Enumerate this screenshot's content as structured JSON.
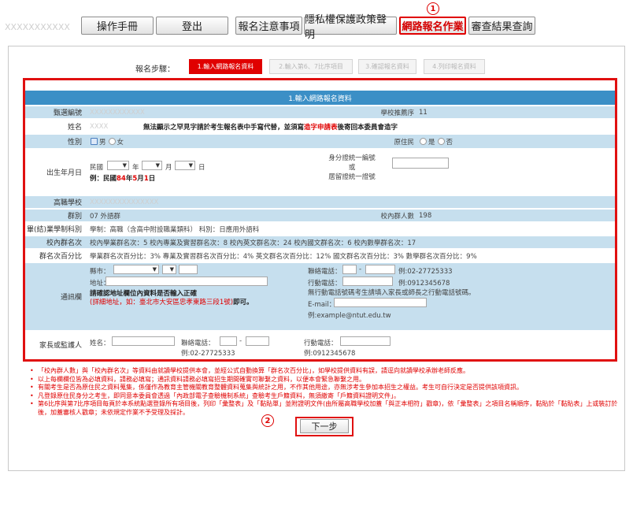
{
  "top": {
    "user_id": "XXXXXXXXXXX",
    "tabs": [
      "操作手冊",
      "登出",
      "報名注意事項",
      "隱私權保護政策聲明",
      "網路報名作業",
      "審查結果查詢"
    ],
    "marker1": "1",
    "marker2": "2"
  },
  "steps": {
    "label": "報名步驟：",
    "items": [
      "1.輸入網路報名資料",
      "2.輸入第6、7比序項目",
      "3.確認報名資料",
      "4.列印報名資料"
    ]
  },
  "form": {
    "title": "1.輸入網路報名資料",
    "exam_no_label": "甄選編號",
    "exam_no_value": "XXXXXXXXXXXX",
    "rank_label": "學校推薦序",
    "rank_value": "11",
    "name_label": "姓名",
    "name_value": "XXXX",
    "name_note_a": "無法顯示之罕見字請於考生報名表中手寫代替，並須寫",
    "name_note_b": "造字申請表",
    "name_note_c": "後寄回本委員會造字",
    "gender_label": "性別",
    "gender_male": "男",
    "gender_female": "女",
    "aboriginal_label": "原住民",
    "aboriginal_yes": "是",
    "aboriginal_no": "否",
    "birth_label": "出生年月日",
    "birth_era": "民國",
    "birth_year": "年",
    "birth_month": "月",
    "birth_day": "日",
    "birth_ex_a": "例：民國",
    "birth_ex_b": "84",
    "birth_ex_c": "年",
    "birth_ex_d": "5",
    "birth_ex_e": "月",
    "birth_ex_f": "1",
    "birth_ex_g": "日",
    "id_label_1": "身分證統一編號",
    "id_label_2": "或",
    "id_label_3": "居留證統一證號",
    "school_label": "高職學校",
    "school_value": "XXXXXXXXXXXXXXX",
    "group_label": "群別",
    "group_value": "07 外語群",
    "group_count_label": "校內群人數",
    "group_count_value": "198",
    "program_label": "畢(結)業學制科別",
    "program_value": "學制：高職（含高中附設職業類科） 科別：日應用外語科",
    "rank_in_school_label": "校內群名次",
    "rank_in_school_value": "校內學業群名次：5   校內專業及實習群名次：8   校內英文群名次：24   校內國文群名次：6   校內數學群名次：17",
    "pct_label": "群名次百分比",
    "pct_value": "學業群名次百分比：3%   專業及實習群名次百分比：4%   英文群名次百分比：12%   國文群名次百分比：3%   數學群名次百分比：9%",
    "contact_label": "通訊欄",
    "county_label": "縣市：",
    "address_label": "地址：",
    "addr_note_1": "請確認地址欄位內資料是否輸入正確",
    "addr_note_2": "(詳細地址，如：臺北市大安區忠孝東路三段1號)",
    "addr_note_3": "即可。",
    "phone_label": "聯絡電話：",
    "phone_ex": "例:02-27725333",
    "mobile_label": "行動電話：",
    "mobile_ex": "例:0912345678",
    "mobile_note": "無行動電話號碼考生請填入家長或師長之行動電話號碼。",
    "email_label": "E-mail：",
    "email_ex": "例:example@ntut.edu.tw",
    "guardian_label": "家長或監護人",
    "guardian_name_label": "姓名：",
    "guardian_phone_label": "聯絡電話：",
    "guardian_phone_ex": "例:02-27725333",
    "guardian_mobile_label": "行動電話：",
    "guardian_mobile_ex": "例:0912345678"
  },
  "notes": [
    "「校內群人數」與「校內群名次」等資料由就讀學校提供本會，並經公式自動換算「群名次百分比」，如學校提供資料有誤，請逕向就讀學校承辦老師反應。",
    "以上每欄欄位皆為必填資料，請務必填寫；通訊資料請務必填寫招生期間確實可聯繫之資料，以便本會緊急聯繫之用。",
    "有關考生是否為原住民之資料蒐集，係僅作為教育主管機關教育整體資料蒐集與統計之用，不作其他用途，亦無涉考生參加本招生之權益。考生可自行決定是否提供該項資訊。",
    "凡登錄原住民身分之考生，即同意本委員會透過「內政部電子查驗機制系統」查驗考生戶籍資料，無須繳寄「戶籍資料證明文件」。",
    "第6比序與第7比序項目每頁於本系統點選登錄所有項目後，列印「彙整表」及「黏貼單」並附證明文件(由所屬高職學校加蓋「與正本相符」戳章)，依「彙整表」之項目名稱順序，黏貼於「黏貼表」上或裝訂於後，加蓋審核人戳章；未依規定作業不予受理及採計。"
  ],
  "next_button": "下一步"
}
